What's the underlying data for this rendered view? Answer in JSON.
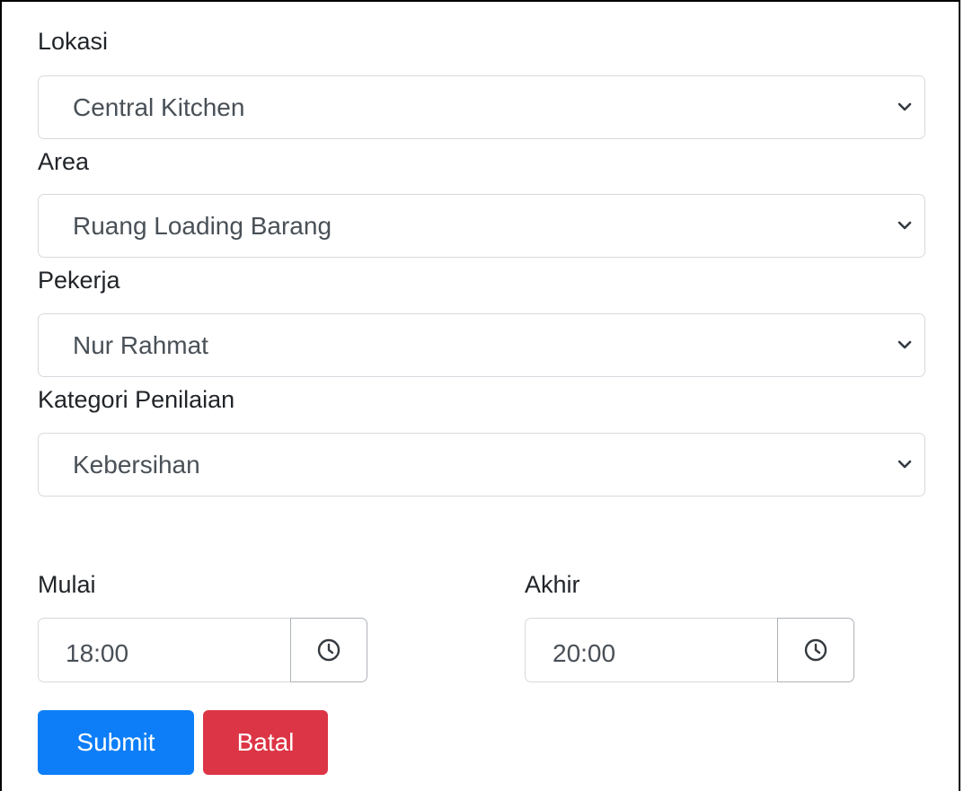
{
  "form": {
    "lokasi": {
      "label": "Lokasi",
      "value": "Central Kitchen"
    },
    "area": {
      "label": "Area",
      "value": "Ruang Loading Barang"
    },
    "pekerja": {
      "label": "Pekerja",
      "value": "Nur Rahmat"
    },
    "kategori": {
      "label": "Kategori Penilaian",
      "value": "Kebersihan"
    },
    "mulai": {
      "label": "Mulai",
      "value": "18:00"
    },
    "akhir": {
      "label": "Akhir",
      "value": "20:00"
    }
  },
  "actions": {
    "submit_label": "Submit",
    "cancel_label": "Batal"
  },
  "colors": {
    "primary": "#0d7ef8",
    "danger": "#dc3545",
    "border": "#d6dade",
    "text": "#212529",
    "input_text": "#495057"
  },
  "icons": {
    "select_arrow": "chevron-down-icon",
    "time_picker": "clock-icon"
  }
}
